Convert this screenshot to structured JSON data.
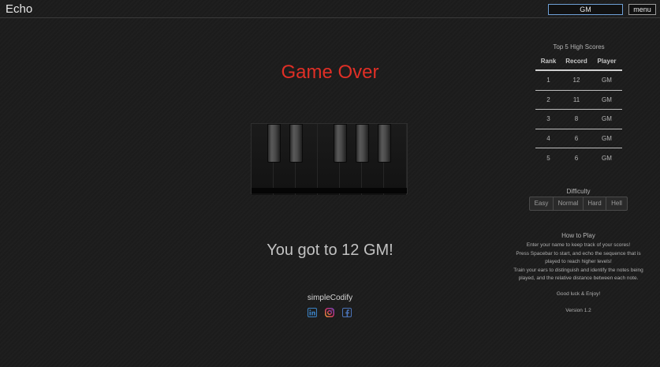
{
  "header": {
    "title": "Echo",
    "name_value": "GM",
    "menu_label": "menu"
  },
  "game": {
    "status_text": "Game Over",
    "result_text": "You got to 12 GM!",
    "status_color": "#e02f26"
  },
  "footer": {
    "brand": "simpleCodify",
    "social_icons": [
      "linkedin-icon",
      "instagram-icon",
      "facebook-icon"
    ]
  },
  "scores": {
    "caption": "Top 5 High Scores",
    "headers": [
      "Rank",
      "Record",
      "Player"
    ],
    "rows": [
      {
        "rank": "1",
        "record": "12",
        "player": "GM"
      },
      {
        "rank": "2",
        "record": "11",
        "player": "GM"
      },
      {
        "rank": "3",
        "record": "8",
        "player": "GM"
      },
      {
        "rank": "4",
        "record": "6",
        "player": "GM"
      },
      {
        "rank": "5",
        "record": "6",
        "player": "GM"
      }
    ]
  },
  "difficulty": {
    "label": "Difficulty",
    "options": [
      "Easy",
      "Normal",
      "Hard",
      "Hell"
    ]
  },
  "how_to_play": {
    "title": "How to Play",
    "lines": [
      "Enter your name to keep track of your scores!",
      "Press Spacebar to start, and echo the sequence that is",
      "played to reach higher levels!",
      "Train your ears to distinguish and identify the notes being",
      "played, and the relative distance between each note."
    ],
    "closing": "Good luck & Enjoy!",
    "version": "Version 1.2"
  }
}
